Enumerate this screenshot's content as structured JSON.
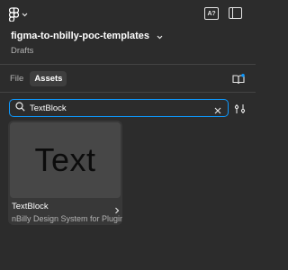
{
  "header": {
    "logo_icon": "figma-logo-icon",
    "dropdown_icon": "chevron-down-icon",
    "ai_button_label": "A?",
    "panel_toggle_icon": "sidebar-toggle-icon"
  },
  "file": {
    "title": "figma-to-nbilly-poc-templates",
    "location": "Drafts"
  },
  "tabs": [
    {
      "label": "File",
      "active": false
    },
    {
      "label": "Assets",
      "active": true
    }
  ],
  "library_icon": "book-icon",
  "search": {
    "value": "TextBlock",
    "icon": "search-icon",
    "clear_icon": "close-icon",
    "filter_icon": "filter-sliders-icon"
  },
  "results": [
    {
      "preview_text": "Text",
      "name": "TextBlock",
      "library": "nBilly Design System for Plugin"
    }
  ],
  "colors": {
    "background": "#2c2c2c",
    "accent": "#0d99ff",
    "card": "#383838",
    "thumbnail": "#474747"
  }
}
